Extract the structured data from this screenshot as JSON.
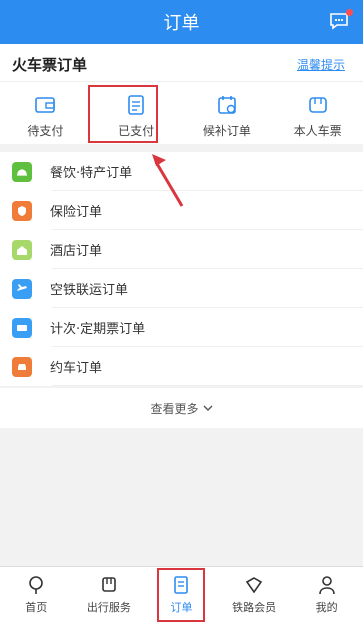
{
  "header": {
    "title": "订单"
  },
  "section": {
    "title": "火车票订单",
    "tip": "温馨提示"
  },
  "tabs": [
    {
      "label": "待支付",
      "icon": "wallet-icon"
    },
    {
      "label": "已支付",
      "icon": "paid-list-icon"
    },
    {
      "label": "候补订单",
      "icon": "waitlist-icon"
    },
    {
      "label": "本人车票",
      "icon": "train-ticket-icon"
    }
  ],
  "list": [
    {
      "label": "餐饮·特产订单",
      "icon": "food-icon",
      "color": "#5fbf3f"
    },
    {
      "label": "保险订单",
      "icon": "insurance-icon",
      "color": "#f07c3a"
    },
    {
      "label": "酒店订单",
      "icon": "hotel-icon",
      "color": "#a6d96a"
    },
    {
      "label": "空铁联运订单",
      "icon": "air-rail-icon",
      "color": "#3b9ef5"
    },
    {
      "label": "计次·定期票订单",
      "icon": "pass-ticket-icon",
      "color": "#3b9ef5"
    },
    {
      "label": "约车订单",
      "icon": "car-icon",
      "color": "#f07c3a"
    }
  ],
  "more": {
    "label": "查看更多"
  },
  "bottom_nav": [
    {
      "label": "首页",
      "icon": "home-icon"
    },
    {
      "label": "出行服务",
      "icon": "travel-service-icon"
    },
    {
      "label": "订单",
      "icon": "order-icon"
    },
    {
      "label": "铁路会员",
      "icon": "member-icon"
    },
    {
      "label": "我的",
      "icon": "profile-icon"
    }
  ],
  "colors": {
    "primary": "#2d8cf0",
    "highlight": "#d9363e"
  }
}
